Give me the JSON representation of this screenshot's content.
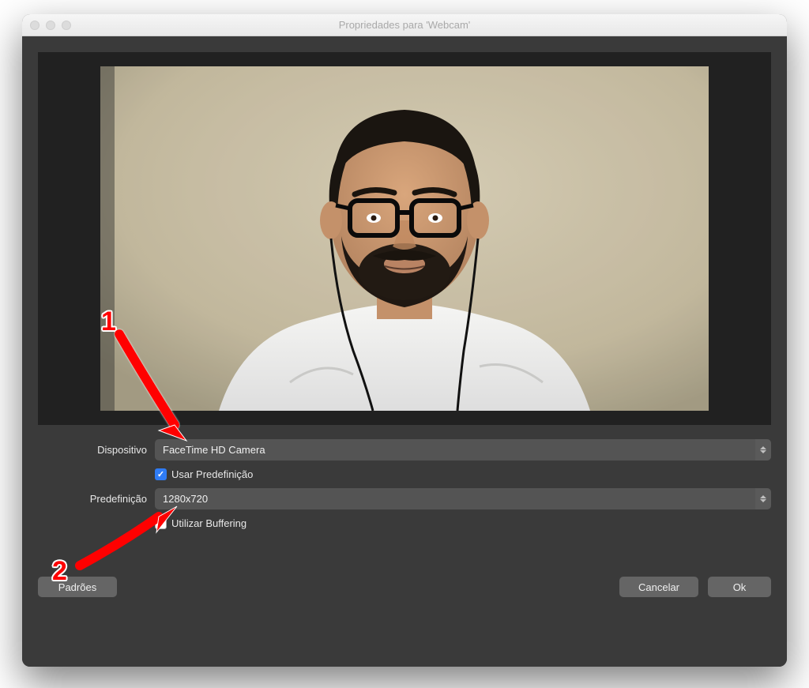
{
  "window": {
    "title": "Propriedades para 'Webcam'"
  },
  "form": {
    "device_label": "Dispositivo",
    "device_value": "FaceTime HD Camera",
    "use_preset_label": "Usar Predefinição",
    "use_preset_checked": true,
    "preset_label": "Predefinição",
    "preset_value": "1280x720",
    "use_buffering_label": "Utilizar Buffering",
    "use_buffering_checked": false
  },
  "buttons": {
    "defaults": "Padrões",
    "cancel": "Cancelar",
    "ok": "Ok"
  },
  "annotations": {
    "one": "1",
    "two": "2"
  }
}
